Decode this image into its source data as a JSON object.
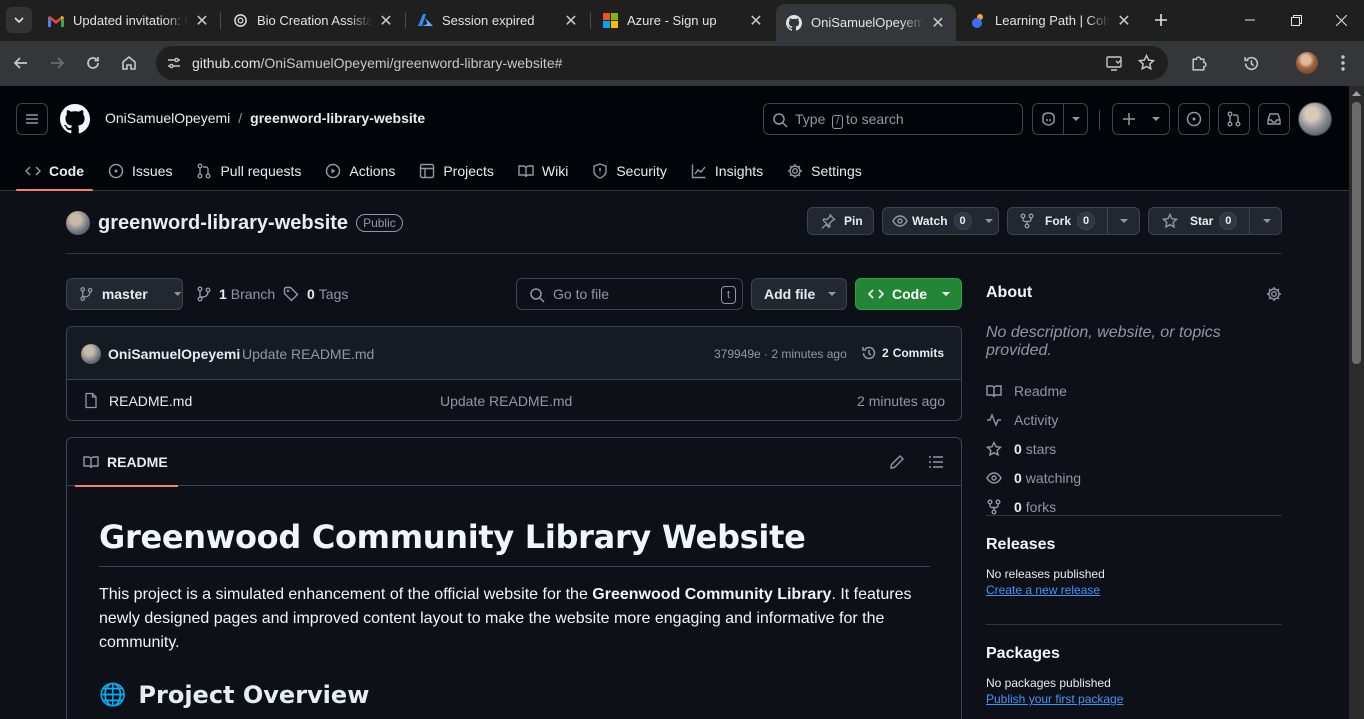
{
  "browser": {
    "tabs": [
      {
        "title": "Updated invitation: Osemudiame",
        "icon": "gmail-icon"
      },
      {
        "title": "Bio Creation Assistance",
        "icon": "openai-icon"
      },
      {
        "title": "Session expired",
        "icon": "azure-icon"
      },
      {
        "title": "Azure - Sign up",
        "icon": "microsoft-icon"
      },
      {
        "title": "OniSamuelOpeyemi/greenword",
        "icon": "github-icon",
        "active": true
      },
      {
        "title": "Learning Path | Cohort",
        "icon": "learning-icon"
      }
    ],
    "url_host": "github.com",
    "url_path": "/OniSamuelOpeyemi/greenword-library-website#"
  },
  "header": {
    "owner": "OniSamuelOpeyemi",
    "separator": "/",
    "repo": "greenword-library-website",
    "search_prefix": "Type",
    "search_key": "/",
    "search_suffix": "to search"
  },
  "nav": {
    "items": [
      {
        "label": "Code",
        "icon": "code-icon"
      },
      {
        "label": "Issues",
        "icon": "issue-icon"
      },
      {
        "label": "Pull requests",
        "icon": "pull-request-icon"
      },
      {
        "label": "Actions",
        "icon": "play-icon"
      },
      {
        "label": "Projects",
        "icon": "table-icon"
      },
      {
        "label": "Wiki",
        "icon": "book-icon"
      },
      {
        "label": "Security",
        "icon": "shield-icon"
      },
      {
        "label": "Insights",
        "icon": "graph-icon"
      },
      {
        "label": "Settings",
        "icon": "gear-icon"
      }
    ]
  },
  "repo": {
    "name": "greenword-library-website",
    "visibility": "Public",
    "pin_label": "Pin",
    "watch_label": "Watch",
    "watch_count": "0",
    "fork_label": "Fork",
    "fork_count": "0",
    "star_label": "Star",
    "star_count": "0"
  },
  "files_bar": {
    "branch": "master",
    "branch_count": "1",
    "branch_label": "Branch",
    "tag_count": "0",
    "tag_label": "Tags",
    "goto_placeholder": "Go to file",
    "goto_key": "t",
    "add_file_label": "Add file",
    "code_label": "Code"
  },
  "commit": {
    "author": "OniSamuelOpeyemi",
    "message": "Update README.md",
    "hash_time": "379949e · 2 minutes ago",
    "commits_count": "2",
    "commits_label": "Commits"
  },
  "files": [
    {
      "name": "README.md",
      "message": "Update README.md",
      "time": "2 minutes ago"
    }
  ],
  "readme": {
    "tab_label": "README",
    "h1": "Greenwood Community Library Website",
    "p_before": "This project is a simulated enhancement of the official website for the ",
    "p_bold": "Greenwood Community Library",
    "p_after": ". It features newly designed pages and improved content layout to make the website more engaging and informative for the community.",
    "h2_emoji": "🌐",
    "h2": "Project Overview"
  },
  "about": {
    "title": "About",
    "description": "No description, website, or topics provided.",
    "readme": "Readme",
    "activity": "Activity",
    "stars_count": "0",
    "stars_label": "stars",
    "watching_count": "0",
    "watching_label": "watching",
    "forks_count": "0",
    "forks_label": "forks"
  },
  "releases": {
    "title": "Releases",
    "empty": "No releases published",
    "link": "Create a new release"
  },
  "packages": {
    "title": "Packages",
    "empty": "No packages published",
    "link": "Publish your first package"
  },
  "colors": {
    "accent_underline": "#f78166",
    "code_button": "#238636",
    "link": "#4493f8"
  }
}
